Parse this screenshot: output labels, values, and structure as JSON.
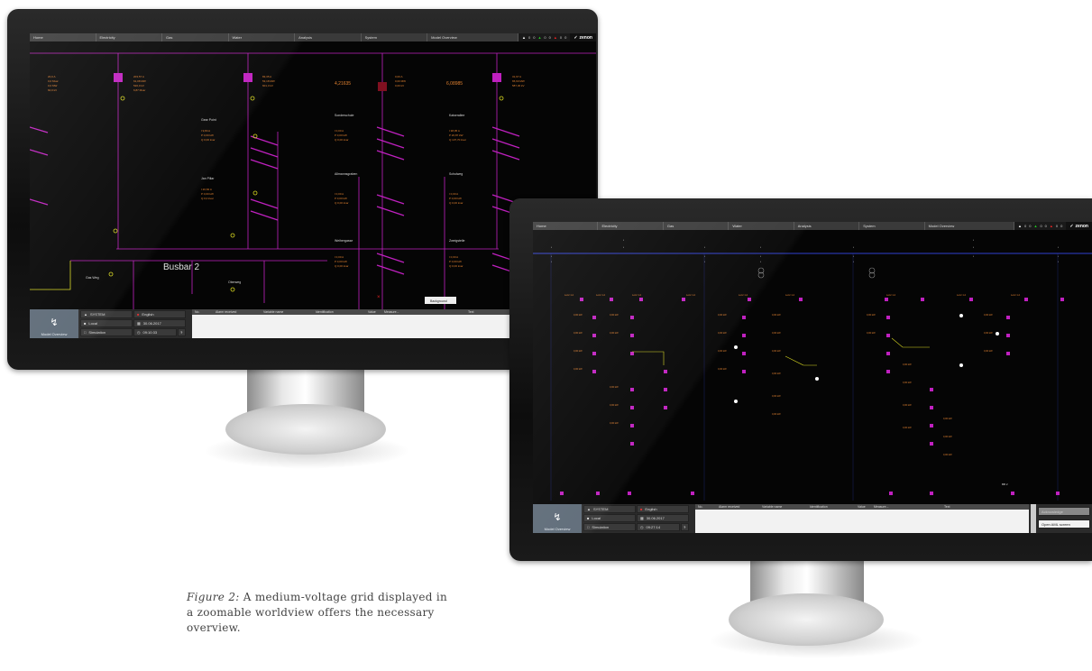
{
  "caption": {
    "label": "Figure 2:",
    "text": "A medium-voltage grid displayed in a zoomable worldview offers the necessary overview."
  },
  "monitor_left": {
    "menu": [
      "Home",
      "Electricity",
      "Gas",
      "Water",
      "Analysis",
      "System",
      "Model Overview"
    ],
    "status_counts": [
      "0",
      "0",
      "0",
      "0",
      "0",
      "0"
    ],
    "logo": "zenon",
    "busbar_label": "Busbar 2",
    "station_labels": [
      "Gear Point",
      "Jan Pillar",
      "Sonderschule",
      "Kaiserallee",
      "Allmannsgraben",
      "Schulweg",
      "Weihergasse",
      "Zweigstelle",
      "Gas Weg",
      "Oberweg"
    ],
    "orange_values": [
      "4,21635",
      "6,08985"
    ],
    "button": "Background",
    "footer": {
      "overview_label": "Model Overview",
      "user": "SYSTEM",
      "location": "Local",
      "mode": "Simulation",
      "language": "English",
      "date": "30.06.2017",
      "time": "09:10:33",
      "help": "?"
    },
    "alarm_columns": [
      "No.",
      "Alarm received",
      "Variable name",
      "Identification",
      "Value",
      "Measure...",
      "Text"
    ]
  },
  "monitor_right": {
    "menu": [
      "Home",
      "Electricity",
      "Gas",
      "Water",
      "Analysis",
      "System",
      "Model Overview"
    ],
    "status_counts": [
      "0",
      "0",
      "0",
      "0",
      "0",
      "0"
    ],
    "logo": "zenon",
    "footer": {
      "overview_label": "Model Overview",
      "user": "SYSTEM",
      "location": "Local",
      "mode": "Simulation",
      "language": "English",
      "date": "30.06.2017",
      "time": "09:27:14",
      "help": "?"
    },
    "alarm_columns": [
      "No.",
      "Alarm received",
      "Variable name",
      "Identification",
      "Value",
      "Measure...",
      "Text"
    ],
    "side_buttons": [
      "Acknowledge",
      "Open AML screen"
    ]
  },
  "colors": {
    "magenta": "#c020c0",
    "orange": "#e08030",
    "yellow": "#d8d820",
    "blue_bus": "#3040d0",
    "footer_blue": "#5e6b78"
  }
}
